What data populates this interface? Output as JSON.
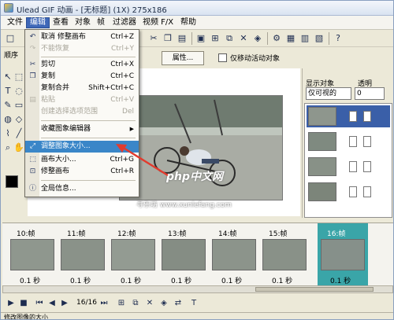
{
  "window": {
    "title": "Ulead GIF 动画 - [无标题] (1X) 275x186"
  },
  "menubar": {
    "items": [
      "文件",
      "编辑",
      "查看",
      "对象",
      "帧",
      "过滤器",
      "视频 F/X",
      "帮助"
    ],
    "active": "编辑"
  },
  "left_panel": {
    "label": "顺序"
  },
  "toolbar2": {
    "properties_label": "属性...",
    "checkbox_label": "仅移动活动对象"
  },
  "right_panel": {
    "show_label": "显示对象",
    "opacity_label": "透明",
    "show_select": "仅可视的",
    "opacity_value": "0"
  },
  "edit_menu": [
    {
      "label": "取消 修整画布",
      "shortcut": "Ctrl+Z",
      "icon": "undo-icon",
      "state": "normal"
    },
    {
      "label": "不能恢复",
      "shortcut": "Ctrl+Y",
      "icon": "redo-icon",
      "state": "disabled"
    },
    {
      "sep": true
    },
    {
      "label": "剪切",
      "shortcut": "Ctrl+X",
      "icon": "scissors-icon",
      "state": "normal"
    },
    {
      "label": "复制",
      "shortcut": "Ctrl+C",
      "icon": "copy-icon",
      "state": "normal"
    },
    {
      "label": "复制合并",
      "shortcut": "Shift+Ctrl+C",
      "icon": "",
      "state": "normal"
    },
    {
      "label": "粘贴",
      "shortcut": "Ctrl+V",
      "icon": "paste-icon",
      "state": "disabled"
    },
    {
      "label": "创建选择选项范围",
      "shortcut": "Del",
      "icon": "",
      "state": "disabled"
    },
    {
      "sep": true
    },
    {
      "label": "收藏图象编辑器",
      "shortcut": "",
      "icon": "",
      "state": "normal",
      "submenu": true
    },
    {
      "sep": true
    },
    {
      "label": "调整图象大小...",
      "shortcut": "",
      "icon": "resize-icon",
      "state": "highlighted"
    },
    {
      "label": "画布大小...",
      "shortcut": "Ctrl+G",
      "icon": "canvas-icon",
      "state": "normal"
    },
    {
      "label": "修整画布",
      "shortcut": "Ctrl+R",
      "icon": "crop-icon",
      "state": "normal"
    },
    {
      "sep": true
    },
    {
      "label": "全局信息...",
      "shortcut": "",
      "icon": "info-icon",
      "state": "normal"
    }
  ],
  "watermark": {
    "logo": "php中文网",
    "site": "寻乐坊 www.xunlefang.com"
  },
  "frames": [
    {
      "label": "10:帧",
      "delay": "0.1 秒"
    },
    {
      "label": "11:帧",
      "delay": "0.1 秒"
    },
    {
      "label": "12:帧",
      "delay": "0.1 秒"
    },
    {
      "label": "13:帧",
      "delay": "0.1 秒"
    },
    {
      "label": "14:帧",
      "delay": "0.1 秒"
    },
    {
      "label": "15:帧",
      "delay": "0.1 秒"
    },
    {
      "label": "16:帧",
      "delay": "0.1 秒",
      "selected": true
    }
  ],
  "playback": {
    "counter": "16/16"
  },
  "status": {
    "text": "修改图像的大小"
  },
  "colors": {
    "menu_highlight": "#3a86c8",
    "selected_frame": "#3aa5a8",
    "annotation_arrow": "#e23b2e"
  }
}
